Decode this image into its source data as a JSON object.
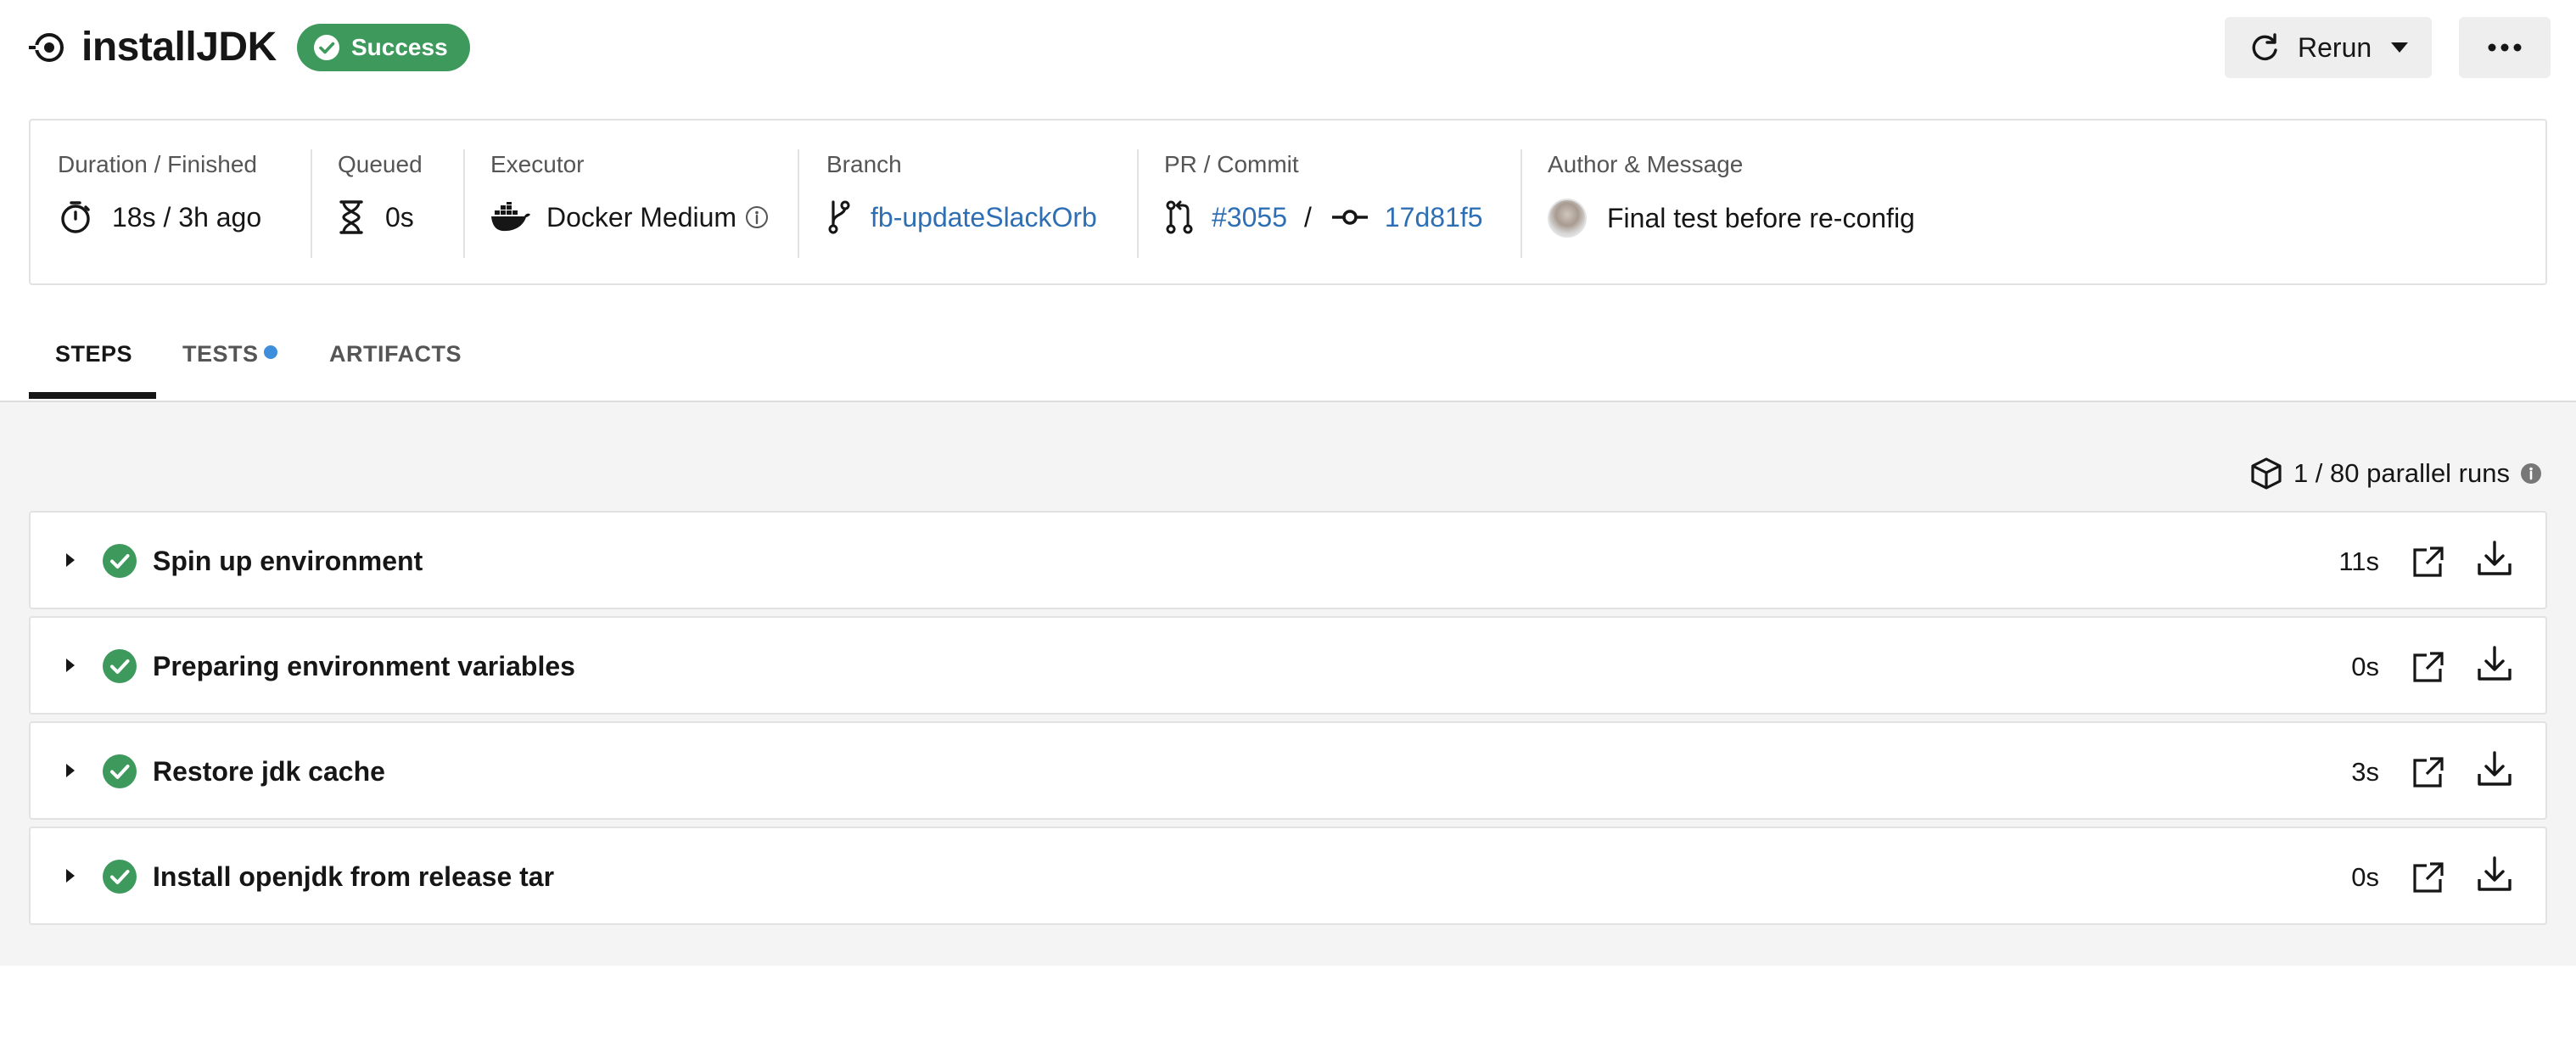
{
  "header": {
    "job_title": "installJDK",
    "status": "Success",
    "rerun_label": "Rerun"
  },
  "meta": {
    "duration": {
      "label": "Duration / Finished",
      "value": "18s / 3h ago"
    },
    "queued": {
      "label": "Queued",
      "value": "0s"
    },
    "executor": {
      "label": "Executor",
      "value": "Docker Medium"
    },
    "branch": {
      "label": "Branch",
      "value": "fb-updateSlackOrb"
    },
    "pr_commit": {
      "label": "PR / Commit",
      "pr": "#3055",
      "separator": "/",
      "commit": "17d81f5"
    },
    "author": {
      "label": "Author & Message",
      "message": "Final test before re-config"
    }
  },
  "tabs": [
    {
      "label": "STEPS",
      "active": true
    },
    {
      "label": "TESTS",
      "active": false
    },
    {
      "label": "ARTIFACTS",
      "active": false
    }
  ],
  "parallel_runs": "1 / 80 parallel runs",
  "steps": [
    {
      "name": "Spin up environment",
      "duration": "11s"
    },
    {
      "name": "Preparing environment variables",
      "duration": "0s"
    },
    {
      "name": "Restore jdk cache",
      "duration": "3s"
    },
    {
      "name": "Install openjdk from release tar",
      "duration": "0s"
    }
  ],
  "colors": {
    "success": "#3e9a5c",
    "link": "#2e6fb3",
    "tests_dot": "#3d8edb"
  }
}
